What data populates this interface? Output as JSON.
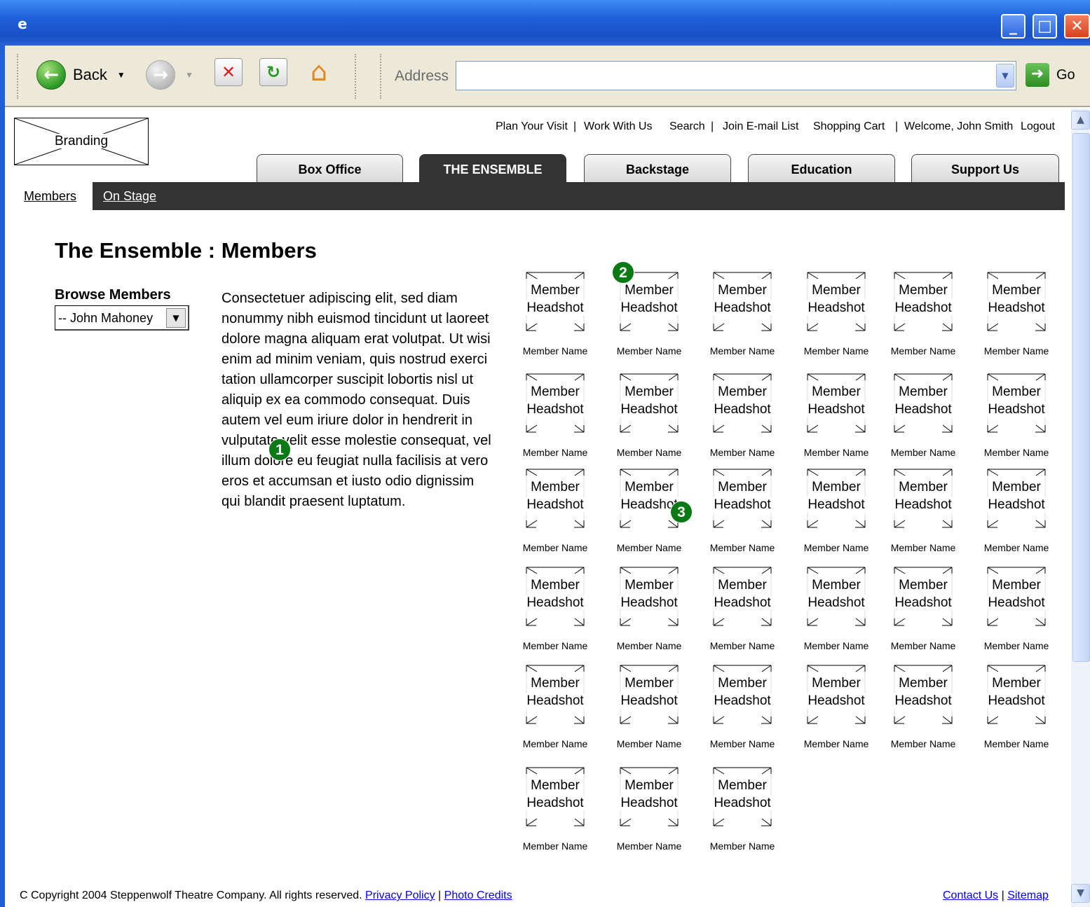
{
  "toolbar": {
    "back_label": "Back",
    "address_label": "Address",
    "address_value": "",
    "go_label": "Go"
  },
  "branding": {
    "label": "Branding"
  },
  "utility_nav": {
    "plan_visit": "Plan Your Visit",
    "work_with_us": "Work With Us",
    "search": "Search",
    "join_email": "Join E-mail List",
    "shopping_cart": "Shopping Cart",
    "welcome": "Welcome, John Smith",
    "logout": "Logout",
    "sep": "|"
  },
  "tabs": [
    {
      "label": "Box Office"
    },
    {
      "label": "THE ENSEMBLE"
    },
    {
      "label": "Backstage"
    },
    {
      "label": "Education"
    },
    {
      "label": "Support Us"
    }
  ],
  "subnav": [
    {
      "label": "Members"
    },
    {
      "label": "On Stage"
    }
  ],
  "page": {
    "title": "The Ensemble : Members",
    "browse_label": "Browse Members",
    "browse_selected": "-- John Mahoney",
    "intro": "Consectetuer adipiscing elit, sed diam nonummy nibh euismod tincidunt ut laoreet dolore magna aliquam erat volutpat. Ut wisi enim ad minim veniam, quis nostrud exerci tation ullamcorper suscipit lobortis nisl ut aliquip ex ea commodo consequat. Duis autem vel eum iriure dolor in hendrerit in vulputate velit esse molestie consequat, vel illum dolore eu feugiat nulla facilisis at vero eros et accumsan et iusto odio dignissim qui blandit praesent luptatum."
  },
  "markers": [
    "1",
    "2",
    "3"
  ],
  "member_card": {
    "headshot_line1": "Member",
    "headshot_line2": "Headshot",
    "name": "Member Name"
  },
  "member_rows": [
    6,
    6,
    6,
    6,
    6,
    3
  ],
  "footer": {
    "copyright": "C Copyright 2004 Steppenwolf Theatre Company. All rights reserved.",
    "privacy": "Privacy Policy",
    "photo_credits": "Photo Credits",
    "contact": "Contact Us",
    "sitemap": "Sitemap",
    "sep": "|"
  }
}
